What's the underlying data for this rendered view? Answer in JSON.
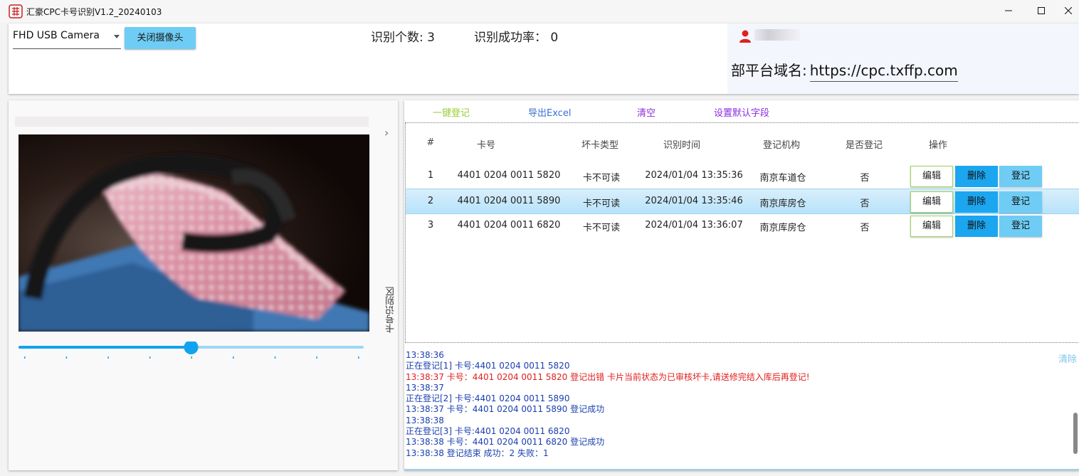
{
  "window": {
    "title": "汇豪CPC卡号识别V1.2_20240103"
  },
  "controls": {
    "camera": "FHD USB Camera",
    "close_camera": "关闭摄像头"
  },
  "stats": {
    "count_label": "识别个数: 3",
    "rate_label": "识别成功率：  0"
  },
  "user": {
    "domain_label": "部平台域名:",
    "domain_value": "https://cpc.txffp.com"
  },
  "side_label": "卡号识别区",
  "slider": {
    "value_fraction": 0.5,
    "ticks": 9
  },
  "toolbar": {
    "one_click_register": "一键登记",
    "export_excel": "导出Excel",
    "clear": "清空",
    "set_default_fields": "设置默认字段"
  },
  "toolbar_colors": {
    "one_click_register": "#9acd32",
    "export_excel": "#3b6fd4",
    "clear": "#8a2be2",
    "set_default_fields": "#8a2be2"
  },
  "table": {
    "headers": [
      "#",
      "卡号",
      "坏卡类型",
      "识别时间",
      "登记机构",
      "是否登记",
      "操作"
    ],
    "rows": [
      {
        "no": "1",
        "card": "4401 0204 0011 5820",
        "type": "卡不可读",
        "time": "2024/01/04 13:35:36",
        "org": "南京车道仓",
        "registered": "否"
      },
      {
        "no": "2",
        "card": "4401 0204 0011 5890",
        "type": "卡不可读",
        "time": "2024/01/04 13:35:46",
        "org": "南京库房仓",
        "registered": "否"
      },
      {
        "no": "3",
        "card": "4401 0204 0011 6820",
        "type": "卡不可读",
        "time": "2024/01/04 13:36:07",
        "org": "南京库房仓",
        "registered": "否"
      }
    ],
    "actions": {
      "edit": "编辑",
      "delete": "删除",
      "register": "登记"
    }
  },
  "log": {
    "clear_label": "清除",
    "lines": [
      {
        "text": "13:38:36",
        "color": "#1a3fb0"
      },
      {
        "text": "正在登记[1] 卡号:4401 0204 0011 5820",
        "color": "#1a3fb0"
      },
      {
        "text": "13:38:37 卡号：4401 0204 0011 5820 登记出错 卡片当前状态为已审核坏卡,请送修完结入库后再登记!",
        "color": "#e01e1e"
      },
      {
        "text": "13:38:37",
        "color": "#1a3fb0"
      },
      {
        "text": "正在登记[2] 卡号:4401 0204 0011 5890",
        "color": "#1a3fb0"
      },
      {
        "text": "13:38:37 卡号：4401 0204 0011 5890 登记成功",
        "color": "#1a3fb0"
      },
      {
        "text": "13:38:38",
        "color": "#1a3fb0"
      },
      {
        "text": "正在登记[3] 卡号:4401 0204 0011 6820",
        "color": "#1a3fb0"
      },
      {
        "text": "13:38:38 卡号：4401 0204 0011 6820 登记成功",
        "color": "#1a3fb0"
      },
      {
        "text": "13:38:38 登记结束 成功：2 失败：1",
        "color": "#1a3fb0"
      }
    ]
  }
}
